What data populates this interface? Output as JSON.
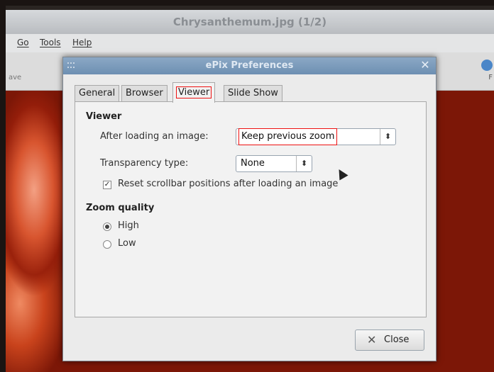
{
  "app": {
    "window_title": "Chrysanthemum.jpg  (1/2)",
    "menu": [
      "Go",
      "Tools",
      "Help"
    ],
    "toolbar_left_label": "ave",
    "toolbar_right_label": "F"
  },
  "dialog": {
    "title": "ePix Preferences",
    "tabs": [
      "General",
      "Browser",
      "Viewer",
      "Slide Show"
    ],
    "active_tab": "Viewer",
    "viewer_section": {
      "title": "Viewer",
      "after_loading_label": "After loading an image:",
      "after_loading_value": "Keep previous zoom",
      "transparency_label": "Transparency type:",
      "transparency_value": "None",
      "reset_scrollbar_label": "Reset scrollbar positions after loading an image",
      "reset_scrollbar_checked": true
    },
    "zoom_section": {
      "title": "Zoom quality",
      "options": [
        "High",
        "Low"
      ],
      "selected": "High"
    },
    "close_label": "Close"
  }
}
